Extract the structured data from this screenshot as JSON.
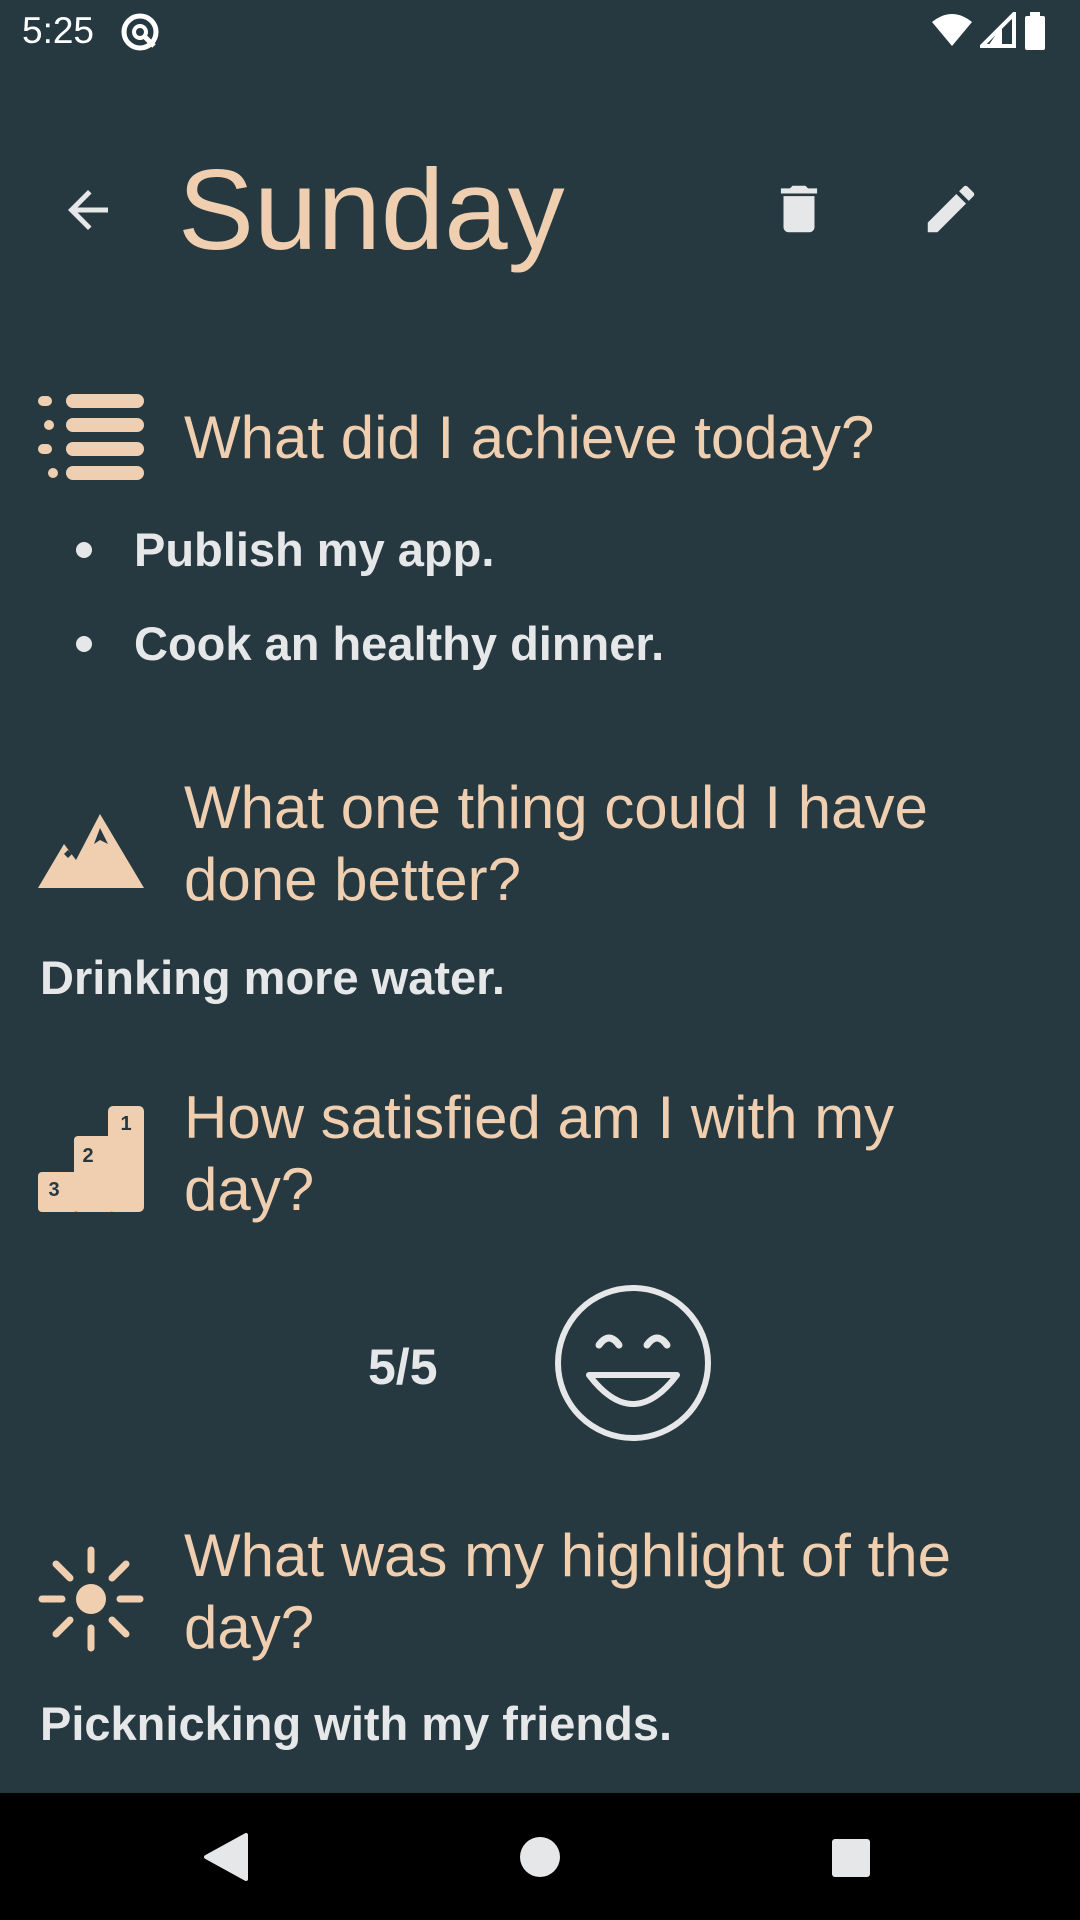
{
  "status_bar": {
    "time": "5:25",
    "left_icon": "data-saver-icon",
    "right_icons": [
      "wifi-icon",
      "cellular-signal-icon",
      "battery-icon"
    ]
  },
  "app_bar": {
    "back_icon": "arrow-back-icon",
    "title": "Sunday",
    "delete_icon": "trash-icon",
    "edit_icon": "pencil-icon"
  },
  "sections": {
    "achievements": {
      "icon": "list-icon",
      "question": "What did I achieve today?",
      "items": [
        "Publish my app.",
        "Cook an healthy dinner."
      ]
    },
    "improvement": {
      "icon": "mountains-icon",
      "question": "What one thing could I have done better?",
      "answer": "Drinking more water."
    },
    "satisfaction": {
      "icon": "podium-icon",
      "question": "How satisfied am I with my day?",
      "score": "5/5",
      "score_value": 5,
      "score_max": 5,
      "face_icon": "smiley-face-icon"
    },
    "highlight": {
      "icon": "sun-icon",
      "question": "What was my highlight of the day?",
      "answer": "Picknicking with my friends."
    }
  },
  "nav_bar": {
    "back_icon": "nav-back-triangle-icon",
    "home_icon": "nav-home-circle-icon",
    "recents_icon": "nav-recents-square-icon"
  },
  "colors": {
    "background": "#263941",
    "accent": "#f0cfb0",
    "text": "#e6e7e8"
  }
}
